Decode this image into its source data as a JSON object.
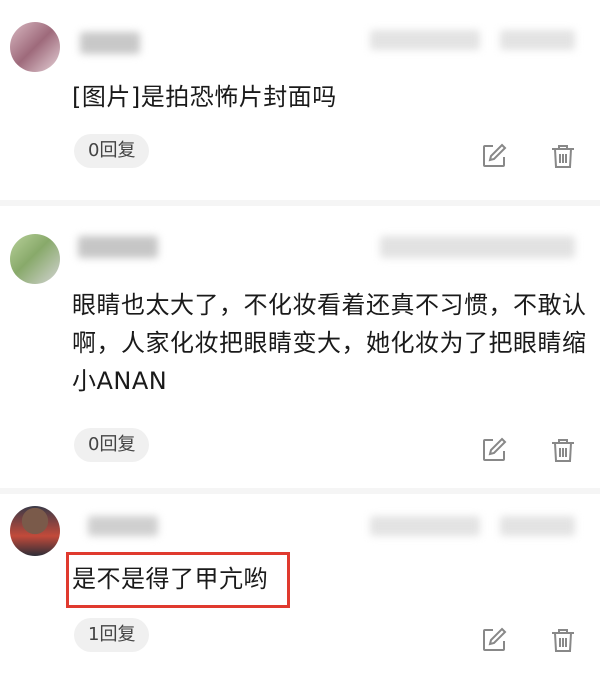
{
  "comments": [
    {
      "text": "[图片]是拍恐怖片封面吗",
      "username": "■■澄",
      "reply_label": "0回复",
      "edit_icon": "edit-icon",
      "delete_icon": "trash-icon"
    },
    {
      "text": "眼睛也太大了，不化妆看着还真不习惯，不敢认啊，人家化妆把眼睛变大，她化妆为了把眼睛缩小ANAN",
      "reply_label": "0回复",
      "edit_icon": "edit-icon",
      "delete_icon": "trash-icon"
    },
    {
      "text": "是不是得了甲亢哟",
      "reply_label": "1回复",
      "edit_icon": "edit-icon",
      "delete_icon": "trash-icon",
      "highlight_color": "#e03a2f"
    }
  ]
}
